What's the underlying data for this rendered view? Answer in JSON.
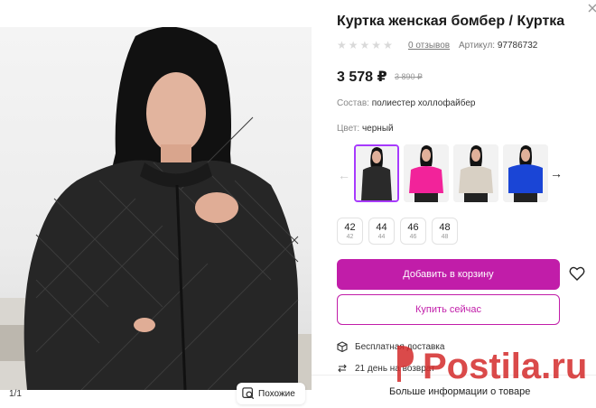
{
  "gallery": {
    "counter": "1/1",
    "similar_label": "Похожие"
  },
  "product": {
    "title": "Куртка женская бомбер / Куртка",
    "reviews": "0 отзывов",
    "article_label": "Артикул:",
    "article_value": "97786732",
    "price": "3 578 ₽",
    "old_price": "3 890 ₽",
    "composition_label": "Состав:",
    "composition_value": "полиестер холлофайбер",
    "color_label": "Цвет:",
    "color_value": "черный",
    "colors": [
      {
        "name": "black",
        "hex": "#2a2a2a"
      },
      {
        "name": "pink",
        "hex": "#f2239a"
      },
      {
        "name": "beige",
        "hex": "#d8d0c4"
      },
      {
        "name": "blue",
        "hex": "#1a45d6"
      }
    ],
    "sizes": [
      {
        "size": "42",
        "sub": "42"
      },
      {
        "size": "44",
        "sub": "44"
      },
      {
        "size": "46",
        "sub": "46"
      },
      {
        "size": "48",
        "sub": "48"
      }
    ]
  },
  "actions": {
    "add_to_cart": "Добавить в корзину",
    "buy_now": "Купить сейчас"
  },
  "services": {
    "delivery": "Бесплатная доставка",
    "returns": "21 день на возврат"
  },
  "footer": {
    "more_info": "Больше информации о товаре"
  },
  "watermark": {
    "text": "Postila.ru"
  },
  "theme": {
    "accent": "#c11da9",
    "selected_border": "#a73afd"
  }
}
